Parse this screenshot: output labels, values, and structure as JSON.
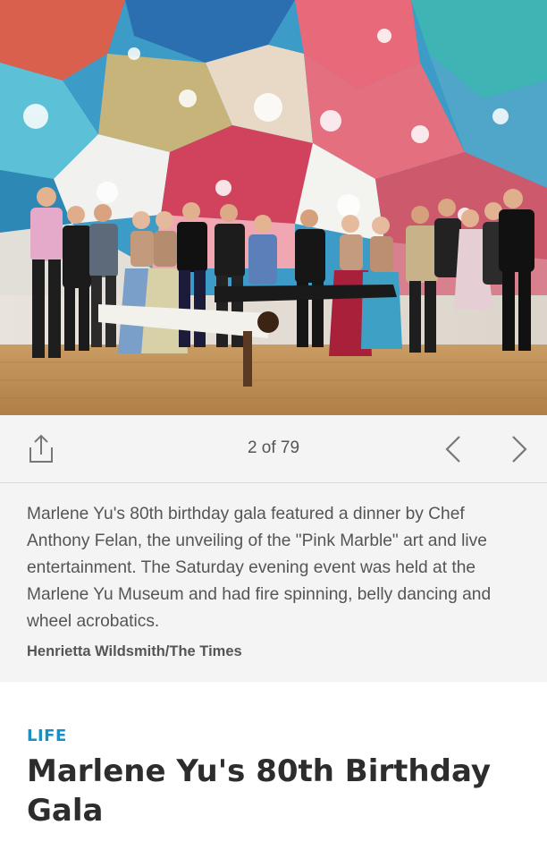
{
  "gallery": {
    "counter": "2 of 79",
    "caption": "Marlene Yu's 80th birthday gala featured a dinner by Chef Anthony Felan, the unveiling of the \"Pink Marble\" art and live entertainment. The Saturday evening event was held at the Marlene Yu Museum and had fire spinning, belly dancing and wheel acrobatics.",
    "credit": "Henrietta Wildsmith/The Times"
  },
  "toolbar": {
    "share_icon": "share-icon",
    "prev_icon": "chevron-left-icon",
    "next_icon": "chevron-right-icon"
  },
  "article": {
    "section": "LIFE",
    "headline": "Marlene Yu's 80th Birthday Gala"
  },
  "colors": {
    "accent": "#1a8fc4",
    "panel_bg": "#f4f4f4",
    "headline": "#2d2d2d"
  }
}
